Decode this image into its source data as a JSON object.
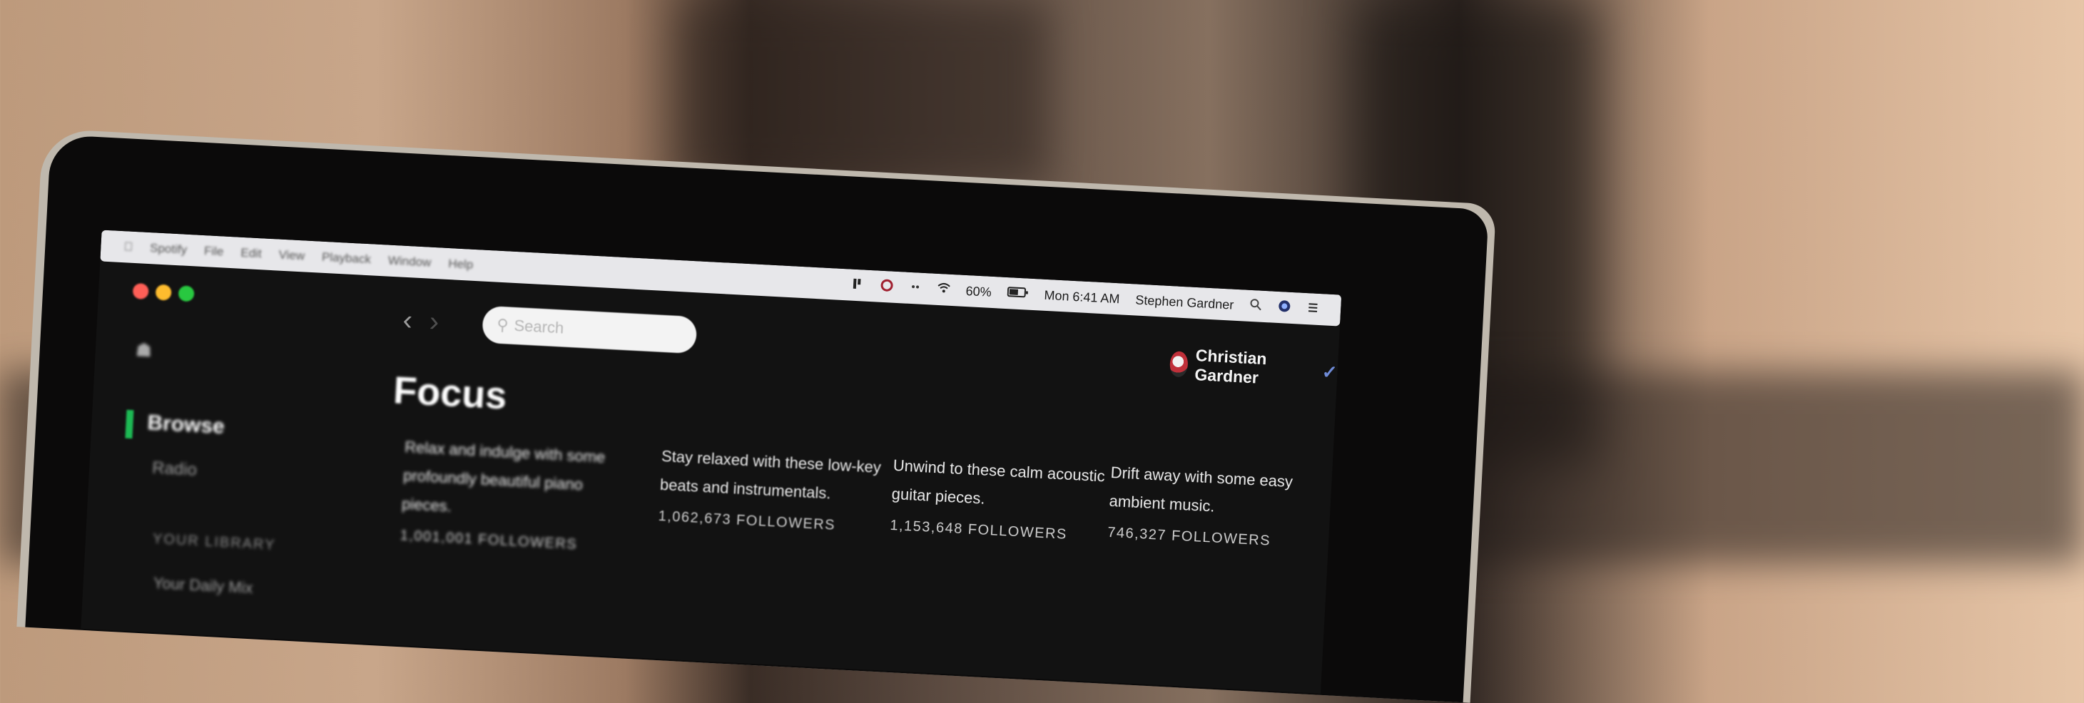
{
  "menubar": {
    "apple_icon": "apple-logo-icon",
    "menus": [
      "Spotify",
      "File",
      "Edit",
      "View",
      "Playback",
      "Window",
      "Help"
    ],
    "battery": "60%",
    "datetime": "Mon 6:41 AM",
    "user_name": "Stephen Gardner"
  },
  "search": {
    "placeholder": "Search"
  },
  "profile": {
    "name": "Christian Gardner"
  },
  "sidebar": {
    "items": [
      "Browse",
      "Radio",
      "YOUR LIBRARY",
      "Your Daily Mix"
    ]
  },
  "page": {
    "title": "Focus"
  },
  "playlists": [
    {
      "description": "Relax and indulge with some profoundly beautiful piano pieces.",
      "followers": "1,001,001 FOLLOWERS"
    },
    {
      "description": "Stay relaxed with these low-key beats and instrumentals.",
      "followers": "1,062,673 FOLLOWERS"
    },
    {
      "description": "Unwind to these calm acoustic guitar pieces.",
      "followers": "1,153,648 FOLLOWERS"
    },
    {
      "description": "Drift away with some easy ambient music.",
      "followers": "746,327 FOLLOWERS"
    }
  ],
  "colors": {
    "spotify_green": "#1db954",
    "background": "#121212"
  }
}
